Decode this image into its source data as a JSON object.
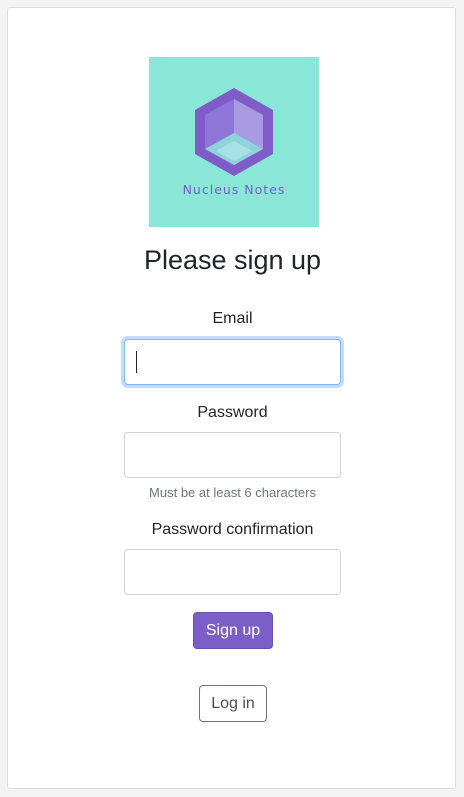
{
  "logo": {
    "text": "Nucleus Notes",
    "background_color": "#8ae6d6",
    "accent_color": "#7c5fc6",
    "icon": "hexagon-cube-icon"
  },
  "page_title": "Please sign up",
  "form": {
    "email": {
      "label": "Email",
      "value": "",
      "focused": true
    },
    "password": {
      "label": "Password",
      "value": "",
      "hint": "Must be at least 6 characters"
    },
    "password_confirmation": {
      "label": "Password confirmation",
      "value": ""
    },
    "submit_label": "Sign up"
  },
  "login_link_label": "Log in",
  "colors": {
    "primary": "#7c5fc6",
    "focus_ring": "#86b7fe",
    "muted_text": "#6c757d"
  }
}
